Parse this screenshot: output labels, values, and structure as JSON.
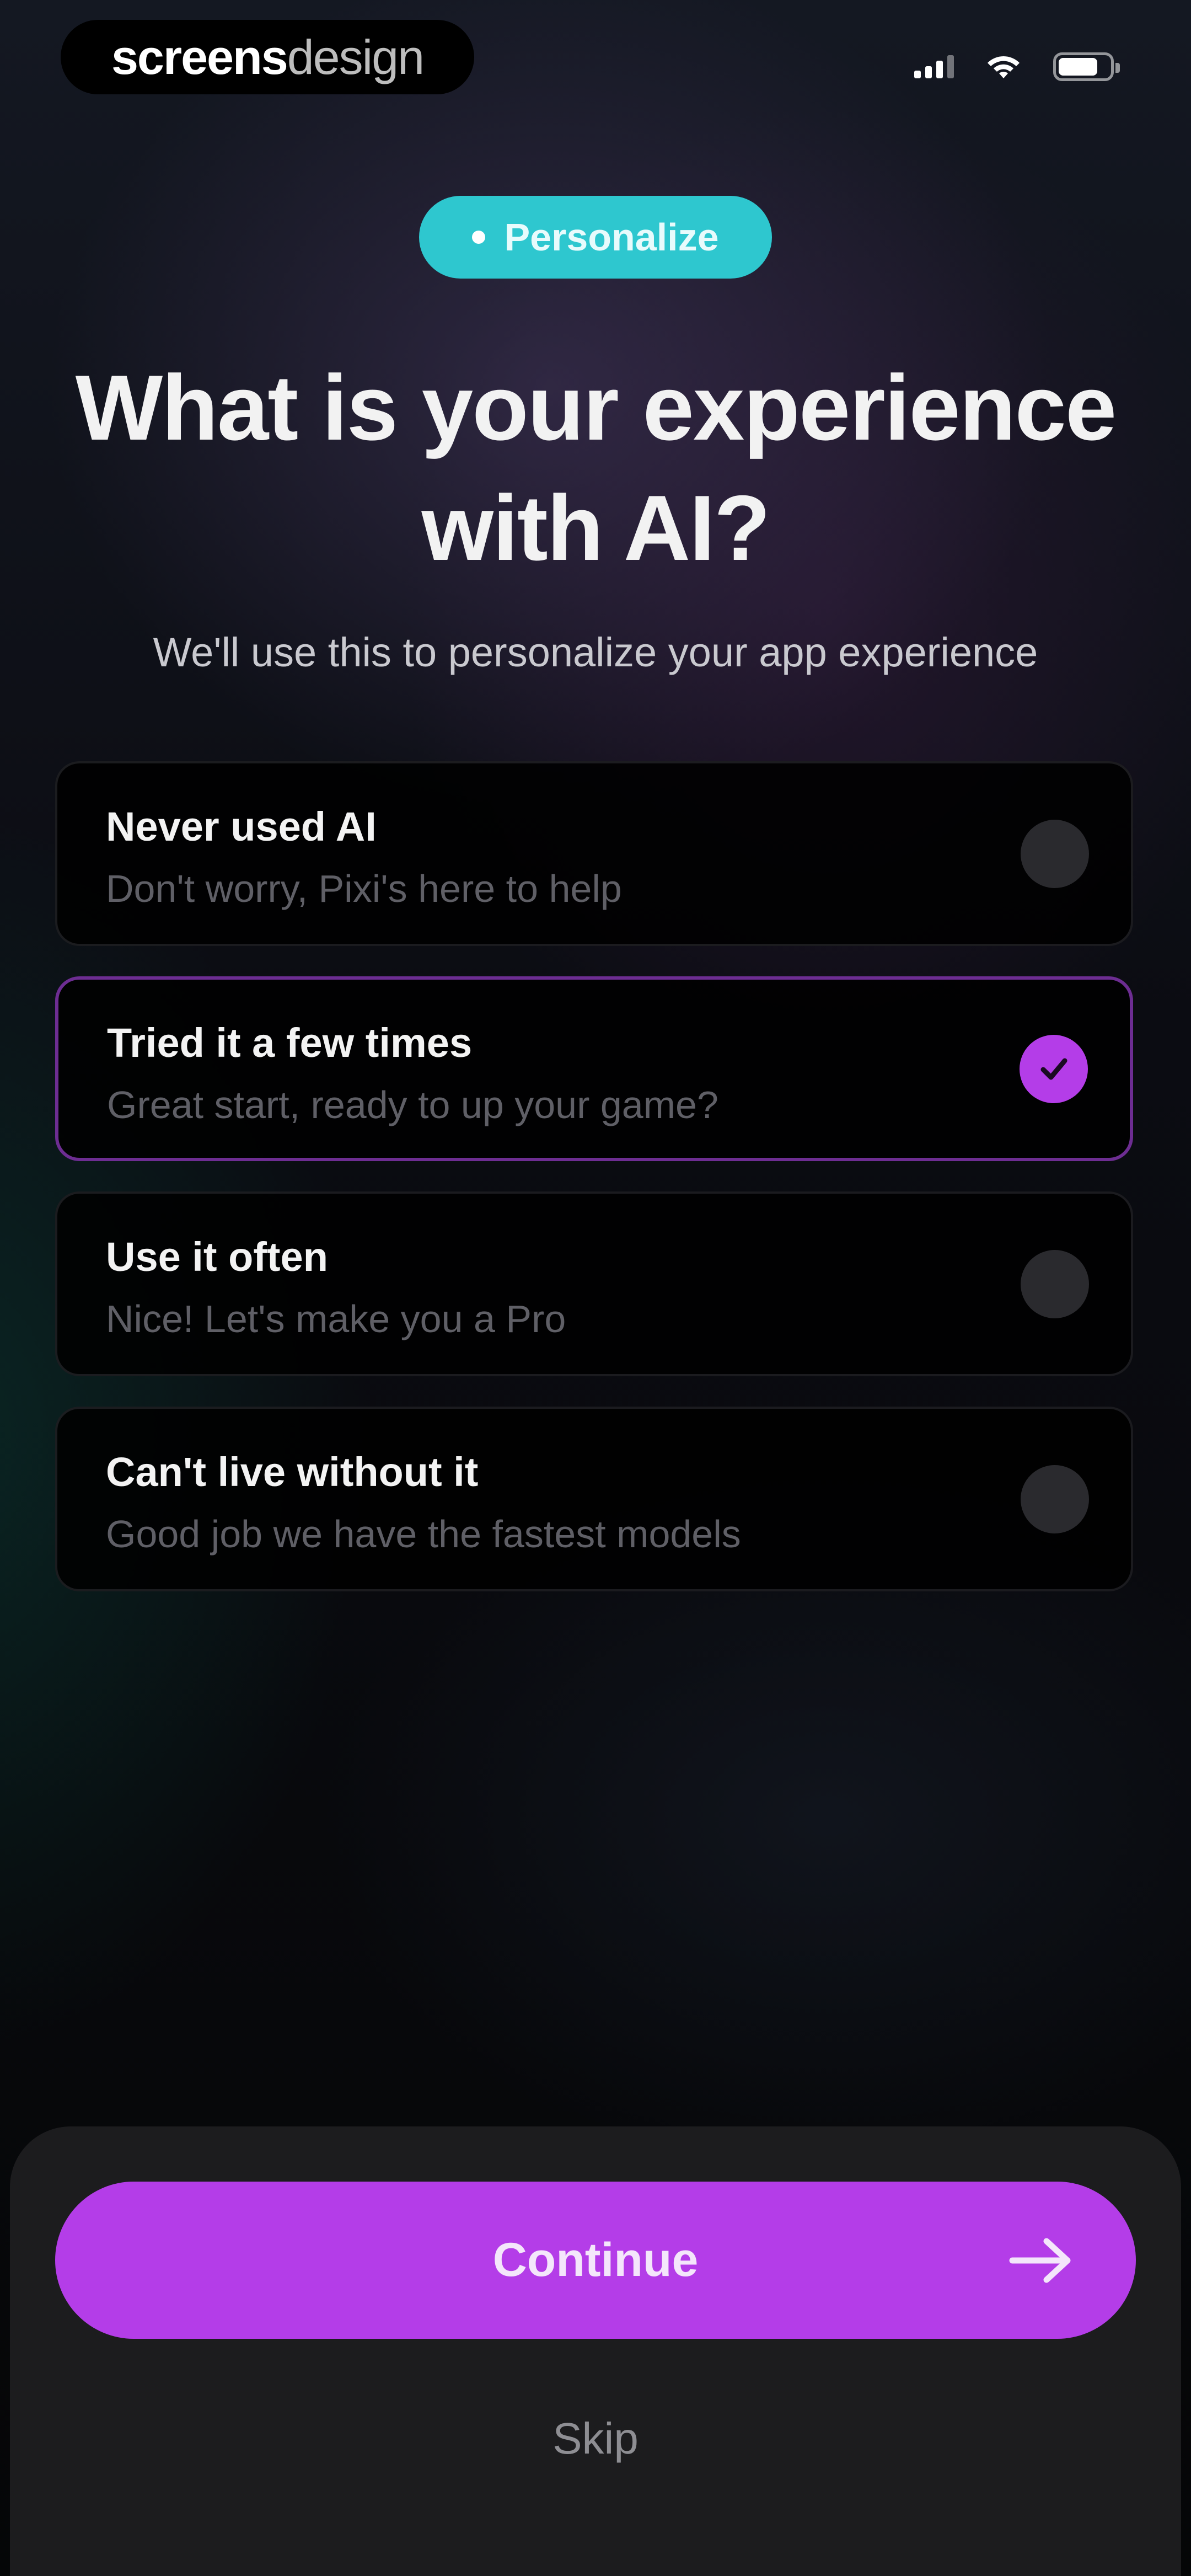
{
  "status_bar": {
    "brand_strong": "screens",
    "brand_light": "design",
    "signal_icon": "signal-icon",
    "wifi_icon": "wifi-icon",
    "battery_icon": "battery-icon",
    "battery_level": 0.7
  },
  "header": {
    "tag_label": "Personalize",
    "title": "What is your experience with AI?",
    "subtitle": "We'll use this to personalize your app experience"
  },
  "options": [
    {
      "title": "Never used AI",
      "description": "Don't worry, Pixi's here to help",
      "selected": false
    },
    {
      "title": "Tried it a few times",
      "description": "Great start, ready to up your game?",
      "selected": true
    },
    {
      "title": "Use it often",
      "description": "Nice! Let's make you a Pro",
      "selected": false
    },
    {
      "title": "Can't live without it",
      "description": "Good job we have the fastest models",
      "selected": false
    }
  ],
  "footer": {
    "continue_label": "Continue",
    "continue_icon": "arrow-right-icon",
    "skip_label": "Skip"
  },
  "colors": {
    "accent": "#b43de8",
    "tag": "#2ec7cf",
    "selected_border": "#6d2d92",
    "sheet": "#1c1c1e"
  }
}
